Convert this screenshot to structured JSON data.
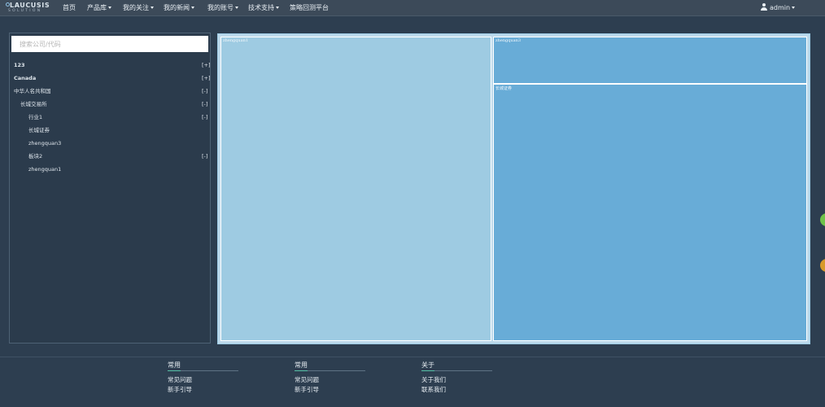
{
  "brand": {
    "line1": "LAUCUSIS",
    "line2": "SOLUTION"
  },
  "nav": {
    "home": "首页",
    "products": "产品库",
    "follow": "我的关注",
    "news": "我的新闻",
    "account": "我的账号",
    "support": "技术支持",
    "platform": "策略回测平台",
    "user": "admin"
  },
  "sidebar": {
    "search_placeholder": "搜索公司/代码",
    "items": [
      {
        "label": "123",
        "toggle": "[+]"
      },
      {
        "label": "Canada",
        "toggle": "[+]"
      },
      {
        "label": "中华人名共和国",
        "toggle": "[-]"
      },
      {
        "label": "长城交易所",
        "toggle": "[-]"
      },
      {
        "label": "行业1",
        "toggle": "[-]"
      },
      {
        "label": "长城证券",
        "toggle": ""
      },
      {
        "label": "zhengquan3",
        "toggle": ""
      },
      {
        "label": "板块2",
        "toggle": "[-]"
      },
      {
        "label": "zhengquan1",
        "toggle": ""
      }
    ]
  },
  "treemap": {
    "cells": [
      {
        "label": "zhengquan1",
        "color": "#9ecbe2"
      },
      {
        "label": "zhengquan3",
        "color": "#68acd7"
      },
      {
        "label": "长城证券",
        "color": "#68acd7"
      }
    ]
  },
  "footer": {
    "col1": {
      "title": "常用",
      "links": [
        "常见问题",
        "新手引导"
      ]
    },
    "col2": {
      "title": "常用",
      "links": [
        "常见问题",
        "新手引导"
      ]
    },
    "col3": {
      "title": "关于",
      "links": [
        "关于我们",
        "联系我们"
      ]
    }
  },
  "colors": {
    "background": "#2d3e50",
    "navbar": "#3c4a59",
    "accent": "#57c1a8"
  }
}
